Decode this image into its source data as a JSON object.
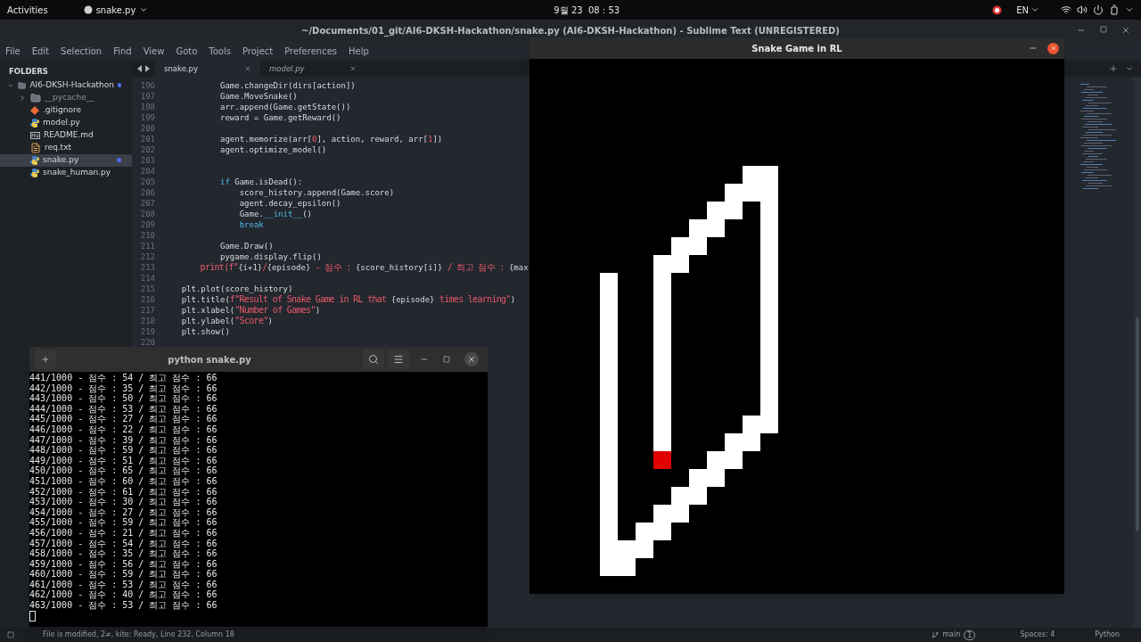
{
  "top_bar": {
    "activities": "Activities",
    "app_menu": "snake.py",
    "clock": "9월 23  08 : 53",
    "language": "EN"
  },
  "editor_window": {
    "title": "~/Documents/01_git/AI6-DKSH-Hackathon/snake.py (AI6-DKSH-Hackathon) - Sublime Text (UNREGISTERED)",
    "menu": [
      "File",
      "Edit",
      "Selection",
      "Find",
      "View",
      "Goto",
      "Tools",
      "Project",
      "Preferences",
      "Help"
    ],
    "sidebar": {
      "heading": "FOLDERS",
      "items": [
        {
          "label": "AI6-DKSH-Hackathon",
          "kind": "folder",
          "expanded": true,
          "modified": true,
          "selected": false,
          "children": [
            {
              "label": "__pycache__",
              "kind": "folder",
              "expanded": false,
              "modified": false,
              "selected": false
            },
            {
              "label": ".gitignore",
              "kind": "git",
              "modified": false,
              "selected": false
            },
            {
              "label": "model.py",
              "kind": "python",
              "modified": false,
              "selected": false
            },
            {
              "label": "README.md",
              "kind": "markdown",
              "modified": false,
              "selected": false
            },
            {
              "label": "req.txt",
              "kind": "text",
              "modified": false,
              "selected": false
            },
            {
              "label": "snake.py",
              "kind": "python",
              "modified": true,
              "selected": true
            },
            {
              "label": "snake_human.py",
              "kind": "python",
              "modified": false,
              "selected": false
            }
          ]
        }
      ]
    },
    "tabs": [
      {
        "label": "snake.py",
        "selected": true
      },
      {
        "label": "model.py",
        "selected": false
      }
    ],
    "code": [
      {
        "number": "196",
        "segments": [
          {
            "kind": "plain",
            "text": "            Game.changeDir(dirs[action])"
          }
        ]
      },
      {
        "number": "197",
        "segments": [
          {
            "kind": "plain",
            "text": "            Game.MoveSnake()"
          }
        ]
      },
      {
        "number": "198",
        "segments": [
          {
            "kind": "plain",
            "text": "            arr.append(Game.getState())"
          }
        ]
      },
      {
        "number": "199",
        "segments": [
          {
            "kind": "plain",
            "text": "            reward = Game.getReward()"
          }
        ]
      },
      {
        "number": "200"
      },
      {
        "number": "201",
        "segments": [
          {
            "kind": "plain",
            "text": "            agent.memorize(arr["
          },
          {
            "kind": "number",
            "text": "0"
          },
          {
            "kind": "plain",
            "text": "], action, reward, arr["
          },
          {
            "kind": "number",
            "text": "1"
          },
          {
            "kind": "plain",
            "text": "])"
          }
        ]
      },
      {
        "number": "202",
        "segments": [
          {
            "kind": "plain",
            "text": "            agent.optimize_model()"
          }
        ]
      },
      {
        "number": "203"
      },
      {
        "number": "204"
      },
      {
        "number": "205",
        "segments": [
          {
            "kind": "keyword",
            "text": "            if"
          },
          {
            "kind": "plain",
            "text": " Game.isDead():"
          }
        ]
      },
      {
        "number": "206",
        "segments": [
          {
            "kind": "plain",
            "text": "                score_history.append(Game.score)"
          }
        ]
      },
      {
        "number": "207",
        "segments": [
          {
            "kind": "plain",
            "text": "                agent.decay_epsilon()"
          }
        ]
      },
      {
        "number": "208",
        "segments": [
          {
            "kind": "plain",
            "text": "                Game."
          },
          {
            "kind": "keyword",
            "text": "__init__"
          },
          {
            "kind": "plain",
            "text": "()"
          }
        ]
      },
      {
        "number": "209",
        "segments": [
          {
            "kind": "keyword",
            "text": "                break"
          }
        ]
      },
      {
        "number": "210"
      },
      {
        "number": "211",
        "segments": [
          {
            "kind": "plain",
            "text": "            Game.Draw()"
          }
        ]
      },
      {
        "number": "212",
        "segments": [
          {
            "kind": "plain",
            "text": "            pygame.display.flip()"
          }
        ]
      },
      {
        "number": "213",
        "segments": [
          {
            "kind": "string",
            "text": "        print(f\""
          },
          {
            "kind": "plain",
            "text": "{i+1}"
          },
          {
            "kind": "string",
            "text": "/"
          },
          {
            "kind": "plain",
            "text": "{episode}"
          },
          {
            "kind": "string",
            "text": " - 점수 : "
          },
          {
            "kind": "plain",
            "text": "{score_history[i]}"
          },
          {
            "kind": "string",
            "text": " / 최고 점수 : "
          },
          {
            "kind": "plain",
            "text": "{max"
          }
        ]
      },
      {
        "number": "214"
      },
      {
        "number": "215",
        "segments": [
          {
            "kind": "plain",
            "text": "    plt.plot(score_history)"
          }
        ]
      },
      {
        "number": "216",
        "segments": [
          {
            "kind": "plain",
            "text": "    plt.title("
          },
          {
            "kind": "string",
            "text": "f\"Result of Snake Game in RL that "
          },
          {
            "kind": "plain",
            "text": "{episode}"
          },
          {
            "kind": "string",
            "text": " times learning\""
          },
          {
            "kind": "plain",
            "text": ")"
          }
        ]
      },
      {
        "number": "217",
        "segments": [
          {
            "kind": "plain",
            "text": "    plt.xlabel("
          },
          {
            "kind": "string",
            "text": "\"Number of Games\""
          },
          {
            "kind": "plain",
            "text": ")"
          }
        ]
      },
      {
        "number": "218",
        "segments": [
          {
            "kind": "plain",
            "text": "    plt.ylabel("
          },
          {
            "kind": "string",
            "text": "\"Score\""
          },
          {
            "kind": "plain",
            "text": ")"
          }
        ]
      },
      {
        "number": "219",
        "segments": [
          {
            "kind": "plain",
            "text": "    plt.show()"
          }
        ]
      },
      {
        "number": "220"
      }
    ],
    "status_bar": {
      "message": "File is modified, 2≠, kite: Ready, Line 232, Column 18",
      "branch": "main",
      "branch_count": "1",
      "indent": "Spaces: 4",
      "syntax": "Python"
    }
  },
  "game_window": {
    "title": "Snake Game in RL"
  },
  "terminal_window": {
    "title": "python snake.py",
    "lines": [
      "441/1000 - 점수 : 54 / 최고 점수 : 66",
      "442/1000 - 점수 : 35 / 최고 점수 : 66",
      "443/1000 - 점수 : 50 / 최고 점수 : 66",
      "444/1000 - 점수 : 53 / 최고 점수 : 66",
      "445/1000 - 점수 : 27 / 최고 점수 : 66",
      "446/1000 - 점수 : 22 / 최고 점수 : 66",
      "447/1000 - 점수 : 39 / 최고 점수 : 66",
      "448/1000 - 점수 : 59 / 최고 점수 : 66",
      "449/1000 - 점수 : 51 / 최고 점수 : 66",
      "450/1000 - 점수 : 65 / 최고 점수 : 66",
      "451/1000 - 점수 : 60 / 최고 점수 : 66",
      "452/1000 - 점수 : 61 / 최고 점수 : 66",
      "453/1000 - 점수 : 30 / 최고 점수 : 66",
      "454/1000 - 점수 : 27 / 최고 점수 : 66",
      "455/1000 - 점수 : 59 / 최고 점수 : 66",
      "456/1000 - 점수 : 21 / 최고 점수 : 66",
      "457/1000 - 점수 : 54 / 최고 점수 : 66",
      "458/1000 - 점수 : 35 / 최고 점수 : 66",
      "459/1000 - 점수 : 56 / 최고 점수 : 66",
      "460/1000 - 점수 : 59 / 최고 점수 : 66",
      "461/1000 - 점수 : 53 / 최고 점수 : 66",
      "462/1000 - 점수 : 40 / 최고 점수 : 66",
      "463/1000 - 점수 : 53 / 최고 점수 : 66"
    ]
  }
}
